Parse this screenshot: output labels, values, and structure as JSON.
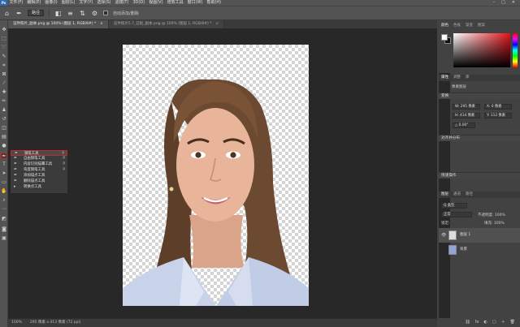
{
  "menubar": {
    "logo": "Ps",
    "items": [
      "文件(F)",
      "编辑(E)",
      "图像(I)",
      "图层(L)",
      "文字(Y)",
      "选择(S)",
      "滤镜(T)",
      "3D(D)",
      "视图(V)",
      "增效工具",
      "窗口(W)",
      "帮助(H)"
    ],
    "controls": [
      "–",
      "□",
      "✕"
    ]
  },
  "options": {
    "shape_mode": "路径",
    "auto_add_delete": "自动添加/删除"
  },
  "tabs": [
    {
      "title": "证件照片_副本.png @ 100% (图层 1, RGB/8#) *",
      "close": "×"
    },
    {
      "title": "证件照片5.7_已抠_副本.png @ 100% (图层 1, RGB/8#) *",
      "close": "×"
    }
  ],
  "flyout": {
    "items": [
      {
        "icon": "✒",
        "label": "钢笔工具",
        "key": "P"
      },
      {
        "icon": "✒",
        "label": "自由钢笔工具",
        "key": "P"
      },
      {
        "icon": "✒",
        "label": "内容识别描摹工具",
        "key": "P"
      },
      {
        "icon": "✒",
        "label": "弯度钢笔工具",
        "key": "P"
      },
      {
        "icon": "✒",
        "label": "添加锚点工具",
        "key": ""
      },
      {
        "icon": "✒",
        "label": "删除锚点工具",
        "key": ""
      },
      {
        "icon": "▸",
        "label": "转换点工具",
        "key": ""
      }
    ]
  },
  "status": {
    "zoom": "100%",
    "doc_info": "295 像素 x 413 像素 (72 ppi)"
  },
  "right_panel": {
    "tabs1": [
      "颜色",
      "色板",
      "渐变",
      "图案"
    ],
    "properties_tabs": [
      "属性",
      "调整",
      "库"
    ],
    "properties_label": "像素图层",
    "transform_title": "变换",
    "w": "W: 295 像素",
    "h": "H: 414 像素",
    "x": "X: 0 像素",
    "y": "Y: 112 像素",
    "angle": "△ 0.00°",
    "align_title": "对齐并分布",
    "quick_actions_title": "快速操作",
    "layers_tabs": [
      "图层",
      "通道",
      "路径"
    ],
    "kind": "Q 类型",
    "blend_mode": "正常",
    "opacity": "不透明度: 100%",
    "lock": "锁定:",
    "fill": "填充: 100%",
    "layers": [
      {
        "name": "图层 1",
        "visible": true
      },
      {
        "name": "背景",
        "visible": false
      }
    ]
  }
}
